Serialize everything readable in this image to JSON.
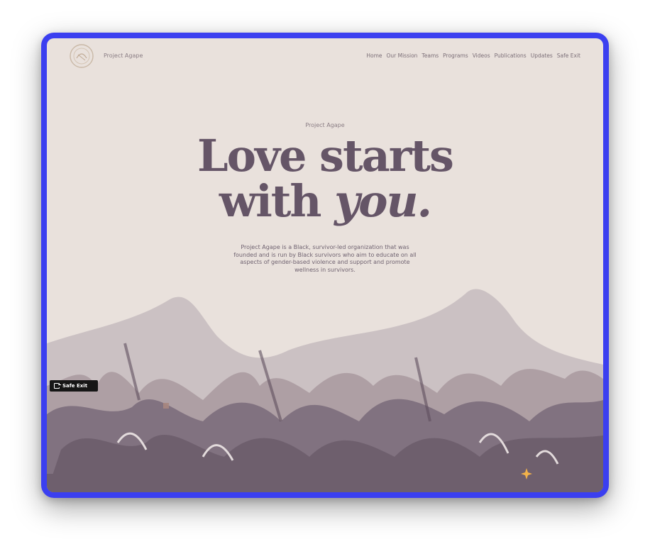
{
  "header": {
    "brand": "Project Agape",
    "nav": [
      "Home",
      "Our Mission",
      "Teams",
      "Programs",
      "Videos",
      "Publications",
      "Updates",
      "Safe Exit"
    ]
  },
  "hero": {
    "eyebrow": "Project Agape",
    "headline_line1": "Love starts",
    "headline_line2_prefix": "with ",
    "headline_line2_emphasis": "you.",
    "description": "Project Agape is a Black, survivor-led organization that was founded and is run by Black survivors who aim to educate on all aspects of gender-based violence and support and promote wellness in survivors."
  },
  "floating_button": {
    "label": "Safe Exit",
    "icon": "exit-icon"
  },
  "colors": {
    "frame": "#3b3ff0",
    "background": "#e9e1dc",
    "headline": "#655567",
    "mountains": "#c7bdbf",
    "foliage": "#7a6a7a",
    "ground": "#6e5f6d",
    "sparkle": "#f2b24a"
  }
}
